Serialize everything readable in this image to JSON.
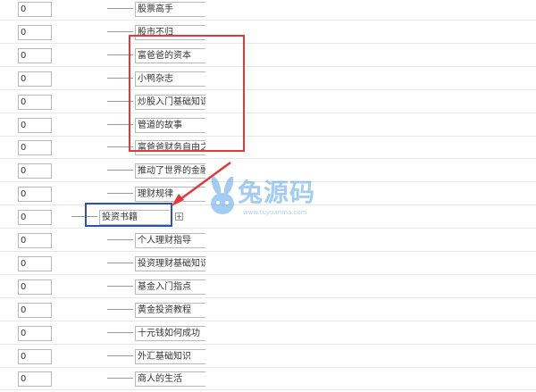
{
  "rows": [
    {
      "order": "0",
      "name": "股票高手",
      "indent": 1
    },
    {
      "order": "0",
      "name": "股市不归",
      "indent": 1
    },
    {
      "order": "0",
      "name": "富爸爸的资本",
      "indent": 1
    },
    {
      "order": "0",
      "name": "小鸭杂志",
      "indent": 1
    },
    {
      "order": "0",
      "name": "炒股入门基础知识",
      "indent": 1
    },
    {
      "order": "0",
      "name": "管道的故事",
      "indent": 1
    },
    {
      "order": "0",
      "name": "富爸爸财务自由之路",
      "indent": 1
    },
    {
      "order": "0",
      "name": "推动了世界的金融",
      "indent": 1
    },
    {
      "order": "0",
      "name": "理财规律",
      "indent": 1
    },
    {
      "order": "0",
      "name": "投资书籍",
      "indent": 0,
      "expand": "+"
    },
    {
      "order": "0",
      "name": "个人理财指导",
      "indent": 1
    },
    {
      "order": "0",
      "name": "投资理财基础知识介绍",
      "indent": 1
    },
    {
      "order": "0",
      "name": "基金入门指点",
      "indent": 1
    },
    {
      "order": "0",
      "name": "黄金投资教程",
      "indent": 1
    },
    {
      "order": "0",
      "name": "十元钱如何成功",
      "indent": 1
    },
    {
      "order": "0",
      "name": "外汇基础知识",
      "indent": 1
    },
    {
      "order": "0",
      "name": "商人的生活",
      "indent": 1
    }
  ],
  "watermark": {
    "text": "兔源码",
    "url": "www.tuyuanma.com"
  },
  "colors": {
    "highlight_red": "#e3393c",
    "highlight_blue": "#2a52be",
    "watermark": "#5aa3e8"
  }
}
